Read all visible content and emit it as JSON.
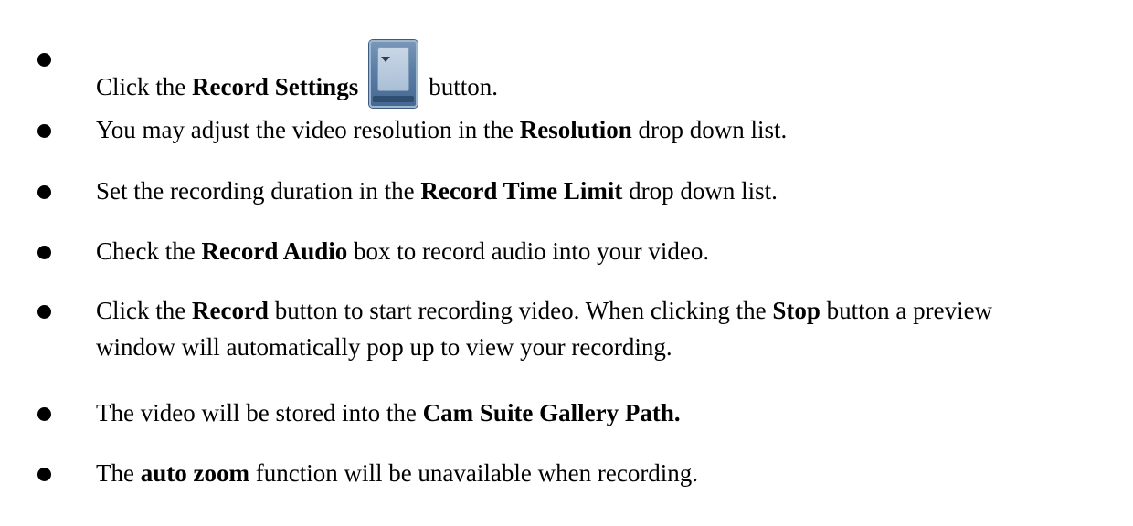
{
  "items": [
    {
      "a": "Click the ",
      "b1": "Record Settings",
      "icon": "record-settings-button-icon",
      "c": "button."
    },
    {
      "a": "You may adjust the video resolution in the ",
      "b1": "Resolution",
      "c": " drop down list."
    },
    {
      "a": "Set the recording duration in the ",
      "b1": "Record Time Limit",
      "c": " drop down list."
    },
    {
      "a": "Check the ",
      "b1": "Record Audio",
      "c": " box to record audio into your video."
    },
    {
      "a": "Click the ",
      "b1": "Record",
      "c": " button to start recording video. When clicking the ",
      "b2": "Stop",
      "d": " button a preview",
      "line2": "window will automatically pop up to view your recording."
    },
    {
      "a": "The video will be stored into the ",
      "b1": "Cam Suite Gallery Path."
    },
    {
      "a": "The ",
      "b1": "auto zoom",
      "c": " function will be unavailable when recording."
    }
  ]
}
